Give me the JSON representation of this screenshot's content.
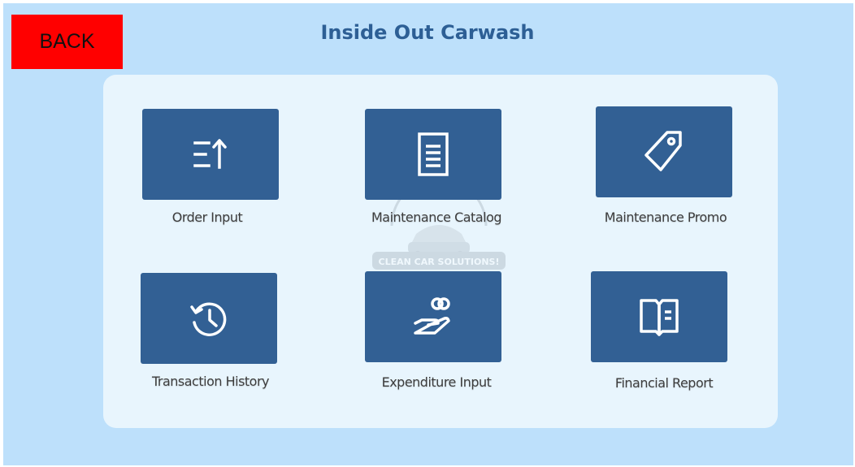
{
  "header": {
    "title": "Inside Out Carwash",
    "back_label": "BACK"
  },
  "watermark": {
    "tagline": "CLEAN CAR SOLUTIONS!"
  },
  "menu": [
    {
      "label": "Order Input",
      "icon": "sort-ascending-icon"
    },
    {
      "label": "Maintenance Catalog",
      "icon": "document-list-icon"
    },
    {
      "label": "Maintenance Promo",
      "icon": "price-tag-icon"
    },
    {
      "label": "Transaction History",
      "icon": "history-clock-icon"
    },
    {
      "label": "Expenditure Input",
      "icon": "hand-coins-icon"
    },
    {
      "label": "Financial Report",
      "icon": "open-book-icon"
    }
  ],
  "colors": {
    "background": "#bde0fb",
    "panel": "#e8f5fd",
    "tile": "#326094",
    "back_button": "#ff0000",
    "title": "#2d5f95"
  }
}
